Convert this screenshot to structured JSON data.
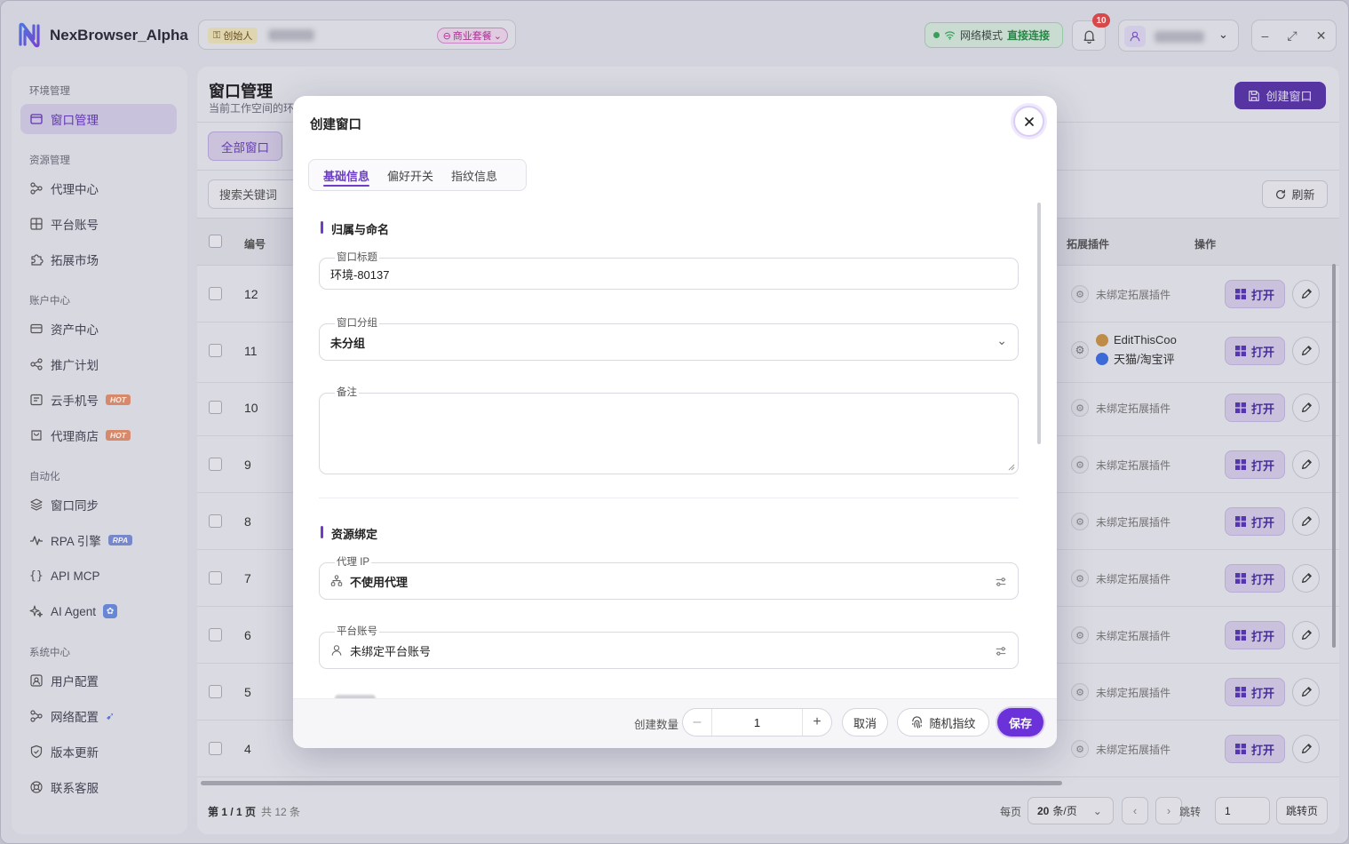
{
  "app": {
    "name": "NexBrowser_Alpha",
    "creator_badge": "创始人",
    "plan_badge": "商业套餐"
  },
  "network": {
    "label": "网络模式",
    "value": "直接连接",
    "color": "#3aa75d"
  },
  "notifications": {
    "count": "10"
  },
  "colors": {
    "accent": "#6a32d8",
    "hot": "#e2916e"
  },
  "sidebar": {
    "sections": [
      {
        "title": "环境管理",
        "items": [
          {
            "label": "窗口管理",
            "icon": "window-icon",
            "active": true
          }
        ]
      },
      {
        "title": "资源管理",
        "items": [
          {
            "label": "代理中心",
            "icon": "proxy-icon"
          },
          {
            "label": "平台账号",
            "icon": "grid-icon"
          },
          {
            "label": "拓展市场",
            "icon": "puzzle-icon"
          }
        ]
      },
      {
        "title": "账户中心",
        "items": [
          {
            "label": "资产中心",
            "icon": "wallet-icon"
          },
          {
            "label": "推广计划",
            "icon": "share-icon"
          },
          {
            "label": "云手机号",
            "icon": "phone-icon",
            "badge": "HOT"
          },
          {
            "label": "代理商店",
            "icon": "store-icon",
            "badge": "HOT"
          }
        ]
      },
      {
        "title": "自动化",
        "items": [
          {
            "label": "窗口同步",
            "icon": "layers-icon"
          },
          {
            "label": "RPA 引擎",
            "icon": "pulse-icon",
            "badge": "RPA"
          },
          {
            "label": "API MCP",
            "icon": "braces-icon"
          },
          {
            "label": "AI Agent",
            "icon": "sparkle-icon"
          }
        ]
      },
      {
        "title": "系统中心",
        "items": [
          {
            "label": "用户配置",
            "icon": "user-config-icon"
          },
          {
            "label": "网络配置",
            "icon": "network-icon"
          },
          {
            "label": "版本更新",
            "icon": "shield-icon"
          },
          {
            "label": "联系客服",
            "icon": "support-icon"
          }
        ]
      }
    ]
  },
  "main": {
    "title": "窗口管理",
    "subtitle": "当前工作空间的环",
    "create_button": "创建窗口",
    "all_windows": "全部窗口",
    "search_placeholder": "搜索关键词",
    "refresh": "刷新",
    "columns": {
      "id": "编号",
      "extension": "拓展插件",
      "action": "操作"
    },
    "rows": [
      {
        "id": "12",
        "ext": "未绑定拓展插件"
      },
      {
        "id": "11",
        "ext1": "EditThisCoo",
        "ext2": "天猫/淘宝评"
      },
      {
        "id": "10",
        "ext": "未绑定拓展插件"
      },
      {
        "id": "9",
        "ext": "未绑定拓展插件"
      },
      {
        "id": "8",
        "ext": "未绑定拓展插件"
      },
      {
        "id": "7",
        "ext": "未绑定拓展插件"
      },
      {
        "id": "6",
        "ext": "未绑定拓展插件"
      },
      {
        "id": "5",
        "ext": "未绑定拓展插件"
      },
      {
        "id": "4",
        "ext": "未绑定拓展插件"
      }
    ],
    "open_label": "打开",
    "pager": {
      "page": "第 1 / 1 页",
      "total": "共 12 条",
      "per_page_label": "每页",
      "per_page_value": "20",
      "per_page_unit": "条/页",
      "jump_label": "跳转",
      "jump_value": "1",
      "jump_button": "跳转页"
    }
  },
  "modal": {
    "title": "创建窗口",
    "tabs": [
      "基础信息",
      "偏好开关",
      "指纹信息"
    ],
    "section1": "归属与命名",
    "window_title_label": "窗口标题",
    "window_title_value": "环境-80137",
    "group_label": "窗口分组",
    "group_value": "未分组",
    "note_label": "备注",
    "section2": "资源绑定",
    "proxy_label": "代理 IP",
    "proxy_value": "不使用代理",
    "account_label": "平台账号",
    "account_value": "未绑定平台账号",
    "qty_label": "创建数量",
    "qty_value": "1",
    "cancel": "取消",
    "random_fp": "随机指纹",
    "save": "保存"
  }
}
